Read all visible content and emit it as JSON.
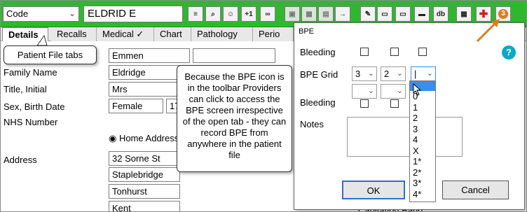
{
  "toolbar": {
    "code_select": "Code",
    "patient_name": "ELDRID E",
    "buttons": [
      {
        "name": "align-icon",
        "glyph": "≡"
      },
      {
        "name": "search-icon",
        "glyph": "⌕"
      },
      {
        "name": "person-icon",
        "glyph": "☺"
      },
      {
        "name": "plus-one-button",
        "glyph": "+1"
      },
      {
        "name": "link-icon",
        "glyph": "∞"
      },
      {
        "name": "save-icon",
        "glyph": "▣"
      },
      {
        "name": "bpe-icon",
        "glyph": "▦"
      },
      {
        "name": "grid-icon",
        "glyph": "▤"
      },
      {
        "name": "merge-icon",
        "glyph": "→"
      },
      {
        "name": "pen-icon",
        "glyph": "✎"
      },
      {
        "name": "document-icon",
        "glyph": "▭"
      },
      {
        "name": "card-icon",
        "glyph": "▭"
      },
      {
        "name": "note-icon",
        "glyph": "▬"
      },
      {
        "name": "db-icon",
        "glyph": "db"
      },
      {
        "name": "calendar-icon",
        "glyph": "▦"
      },
      {
        "name": "medical-alert-icon",
        "glyph": "✚"
      },
      {
        "name": "badge-icon",
        "glyph": "⬤"
      }
    ],
    "badge_value": "3"
  },
  "tabs": [
    "Details",
    "Recalls",
    "Medical ✓",
    "Chart",
    "Pathology",
    "Perio"
  ],
  "form": {
    "labels": {
      "first_name": "",
      "family_name": "Family Name",
      "title_initial": "Title, Initial",
      "sex_birth": "Sex, Birth Date",
      "nhs": "NHS Number",
      "address": "Address"
    },
    "values": {
      "first_name": "Emmen",
      "family_name": "Eldridge",
      "title": "Mrs",
      "sex": "Female",
      "birth_partial": "17",
      "home_address": "Home Address",
      "address1": "32 Sorne St",
      "address2": "Staplebridge",
      "address3": "Tonhurst",
      "address4": "Kent",
      "capitation": "Capitation Band"
    }
  },
  "callouts": {
    "tabs_label": "Patient File tabs",
    "bpe_note": "Because the BPE icon is in the toolbar Providers can click to access the BPE screen irrespective of the open tab - they can record BPE from anywhere in the patient file"
  },
  "dialog": {
    "title": "BPE",
    "bleeding_label": "Bleeding",
    "bpe_grid_label": "BPE Grid",
    "bleeding_label2": "Bleeding",
    "notes_label": "Notes",
    "combo_values": [
      "3",
      "2",
      "|"
    ],
    "dropdown_options": [
      "",
      "0",
      "1",
      "2",
      "3",
      "4",
      "X",
      "1*",
      "2*",
      "3*",
      "4*"
    ],
    "ok_label": "OK",
    "cancel_label": "Cancel",
    "help_label": "?"
  },
  "colors": {
    "toolbar_green": "#2fb82f",
    "accent_orange": "#e07a1e",
    "selection_blue": "#3a8ee6"
  }
}
